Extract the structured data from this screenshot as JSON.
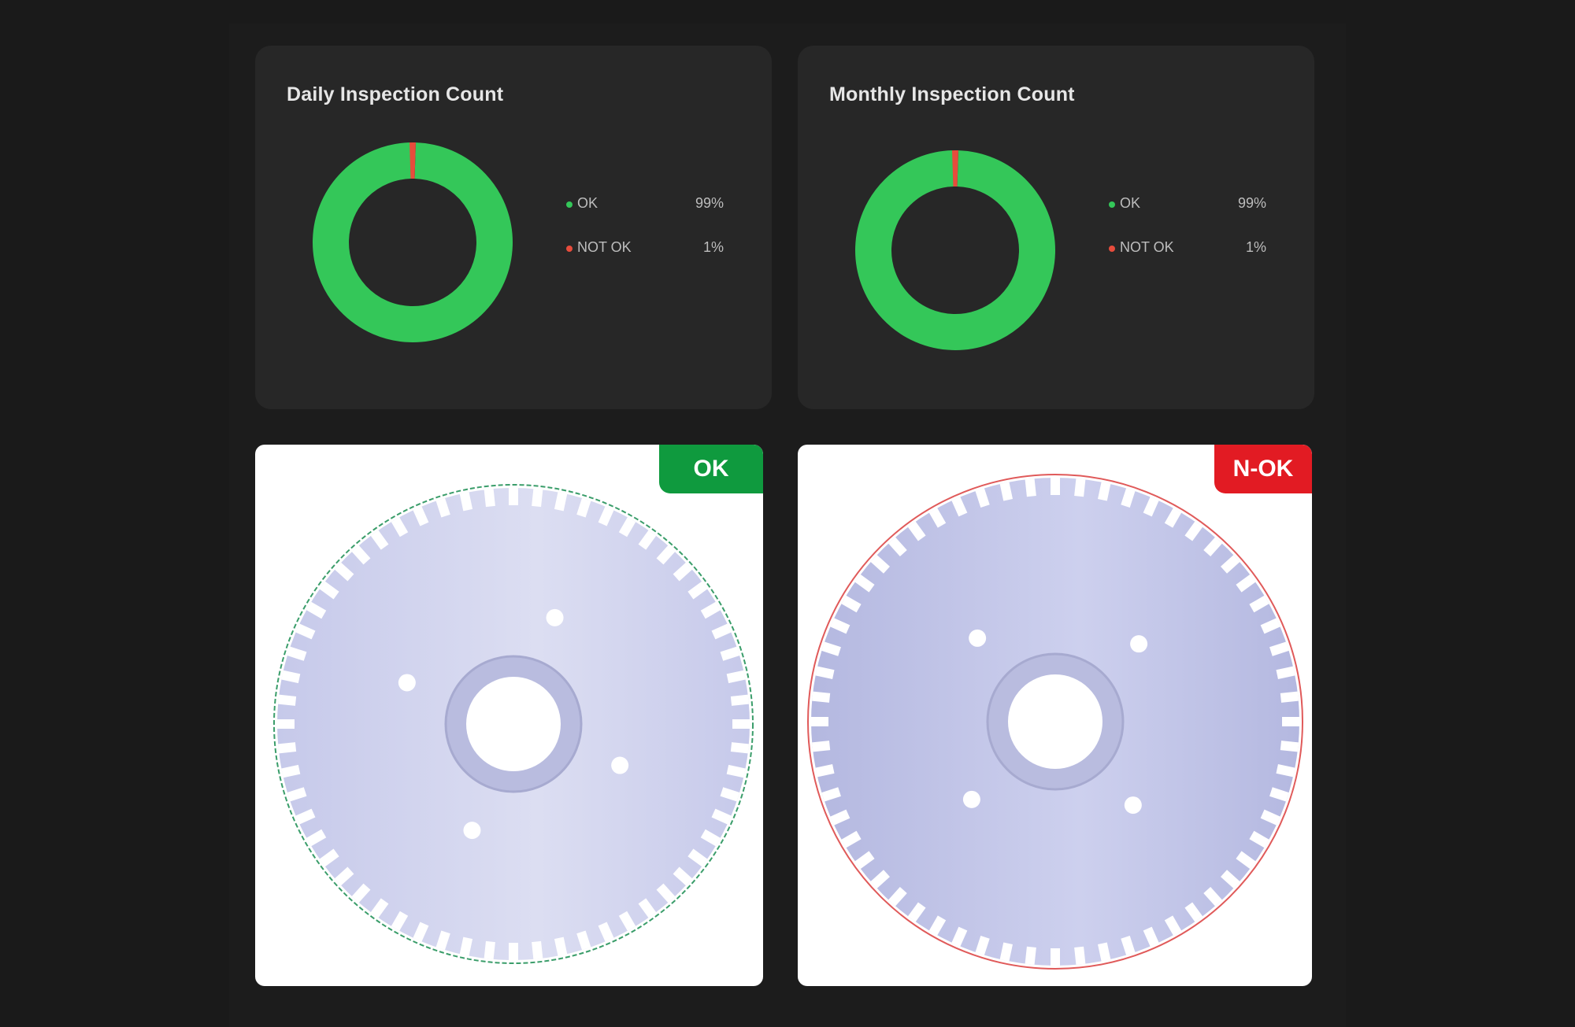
{
  "daily": {
    "title": "Daily Inspection Count",
    "chart_data": {
      "type": "pie",
      "categories": [
        "OK",
        "NOT OK"
      ],
      "values": [
        99,
        1
      ],
      "value_labels": [
        "99%",
        "1%"
      ],
      "title": "Daily Inspection Count"
    },
    "legend": [
      {
        "label": "OK",
        "value": "99%",
        "color": "#34c759"
      },
      {
        "label": "NOT OK",
        "value": "1%",
        "color": "#e74c3c"
      }
    ]
  },
  "monthly": {
    "title": "Monthly Inspection Count",
    "chart_data": {
      "type": "pie",
      "categories": [
        "OK",
        "NOT OK"
      ],
      "values": [
        99,
        1
      ],
      "value_labels": [
        "99%",
        "1%"
      ],
      "title": "Monthly Inspection Count"
    },
    "legend": [
      {
        "label": "OK",
        "value": "99%",
        "color": "#34c759"
      },
      {
        "label": "NOT OK",
        "value": "1%",
        "color": "#e74c3c"
      }
    ]
  },
  "inspections": [
    {
      "status": "OK",
      "badge_color": "#0f9a3e",
      "outline_color": "#3a9d6a"
    },
    {
      "status": "N-OK",
      "badge_color": "#e21b23",
      "outline_color": "#e05a5a"
    }
  ],
  "colors": {
    "ok": "#34c759",
    "not_ok": "#e74c3c",
    "card_bg": "#272727",
    "page_bg": "#1a1a1a"
  }
}
